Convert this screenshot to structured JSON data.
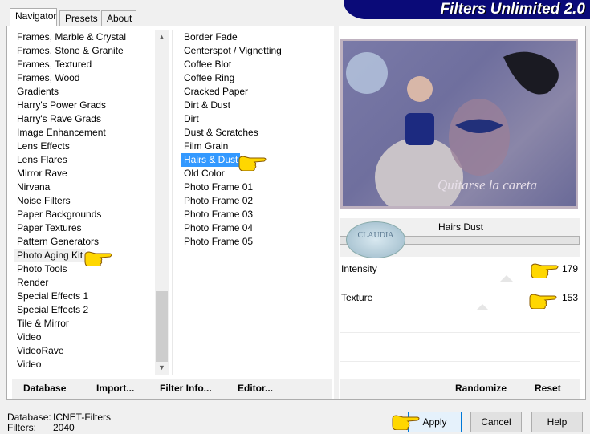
{
  "title": "Filters Unlimited 2.0",
  "tabs": [
    {
      "label": "Navigator",
      "active": true
    },
    {
      "label": "Presets",
      "active": false
    },
    {
      "label": "About",
      "active": false
    }
  ],
  "categories": {
    "items": [
      "Frames, Marble & Crystal",
      "Frames, Stone & Granite",
      "Frames, Textured",
      "Frames, Wood",
      "Gradients",
      "Harry's Power Grads",
      "Harry's Rave Grads",
      "Image Enhancement",
      "Lens Effects",
      "Lens Flares",
      "Mirror Rave",
      "Nirvana",
      "Noise Filters",
      "Paper Backgrounds",
      "Paper Textures",
      "Pattern Generators",
      "Photo Aging Kit",
      "Photo Tools",
      "Render",
      "Special Effects 1",
      "Special Effects 2",
      "Tile & Mirror",
      "Video",
      "VideoRave",
      "Video"
    ],
    "selected": "Photo Aging Kit"
  },
  "filters": {
    "items": [
      "Border Fade",
      "Centerspot / Vignetting",
      "Coffee Blot",
      "Coffee Ring",
      "Cracked Paper",
      "Dirt & Dust",
      "Dirt",
      "Dust & Scratches",
      "Film Grain",
      "Hairs & Dust",
      "Old Color",
      "Photo Frame 01",
      "Photo Frame 02",
      "Photo Frame 03",
      "Photo Frame 04",
      "Photo Frame 05"
    ],
    "selected": "Hairs & Dust"
  },
  "preview": {
    "caption": "Quitarse la careta",
    "watermark": "CLAUDIA"
  },
  "filter_name": "Hairs  Dust",
  "params": [
    {
      "label": "Intensity",
      "value": "179",
      "fraction": 0.7
    },
    {
      "label": "Texture",
      "value": "153",
      "fraction": 0.6
    }
  ],
  "toolbar": {
    "database": "Database",
    "import": "Import...",
    "filter_info": "Filter Info...",
    "editor": "Editor...",
    "randomize": "Randomize",
    "reset": "Reset"
  },
  "status": {
    "database_label": "Database:",
    "database_value": "ICNET-Filters",
    "filters_label": "Filters:",
    "filters_value": "2040"
  },
  "buttons": {
    "apply": "Apply",
    "cancel": "Cancel",
    "help": "Help"
  },
  "colors": {
    "banner": "#0a0a78",
    "selection": "#3399ff",
    "pointer": "#ffd700"
  }
}
